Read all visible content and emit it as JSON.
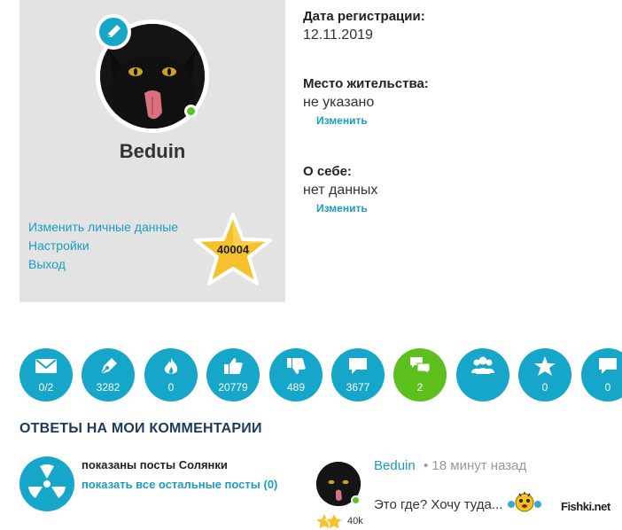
{
  "profile": {
    "username": "Beduin",
    "rating": "40004",
    "links": [
      "Изменить личные данные",
      "Настройки",
      "Выход"
    ]
  },
  "info": {
    "registration_label": "Дата регистрации:",
    "registration_value": "12.11.2019",
    "location_label": "Место жительства:",
    "location_value": "не указано",
    "location_edit": "Изменить",
    "about_label": "О себе:",
    "about_value": "нет данных",
    "about_edit": "Изменить"
  },
  "stats": [
    {
      "icon": "envelope-icon",
      "count": "0/2"
    },
    {
      "icon": "pen-nib-icon",
      "count": "3282"
    },
    {
      "icon": "flame-icon",
      "count": "0"
    },
    {
      "icon": "thumbs-up-icon",
      "count": "20779"
    },
    {
      "icon": "thumbs-down-icon",
      "count": "489"
    },
    {
      "icon": "comment-icon",
      "count": "3677"
    },
    {
      "icon": "comments-icon",
      "count": "2",
      "active": true
    },
    {
      "icon": "users-icon",
      "count": ""
    },
    {
      "icon": "star-icon",
      "count": "0"
    },
    {
      "icon": "comment-icon",
      "count": "0"
    }
  ],
  "colors": {
    "accent": "#15a6c9",
    "active": "#5cbf1b",
    "link": "#1a9cc2",
    "card": "#e3e3e3"
  },
  "section": {
    "title": "ОТВЕТЫ НА МОИ КОММЕНТАРИИ"
  },
  "solyanka": {
    "icon": "radiation-icon",
    "title": "показаны посты Солянки",
    "link": "показать все остальные посты (0)"
  },
  "comment": {
    "author": "Beduin",
    "meta": "• 18 минут назад",
    "text": "Это где? Хочу туда...",
    "karma": "40k"
  },
  "watermark": "Fishki.net"
}
